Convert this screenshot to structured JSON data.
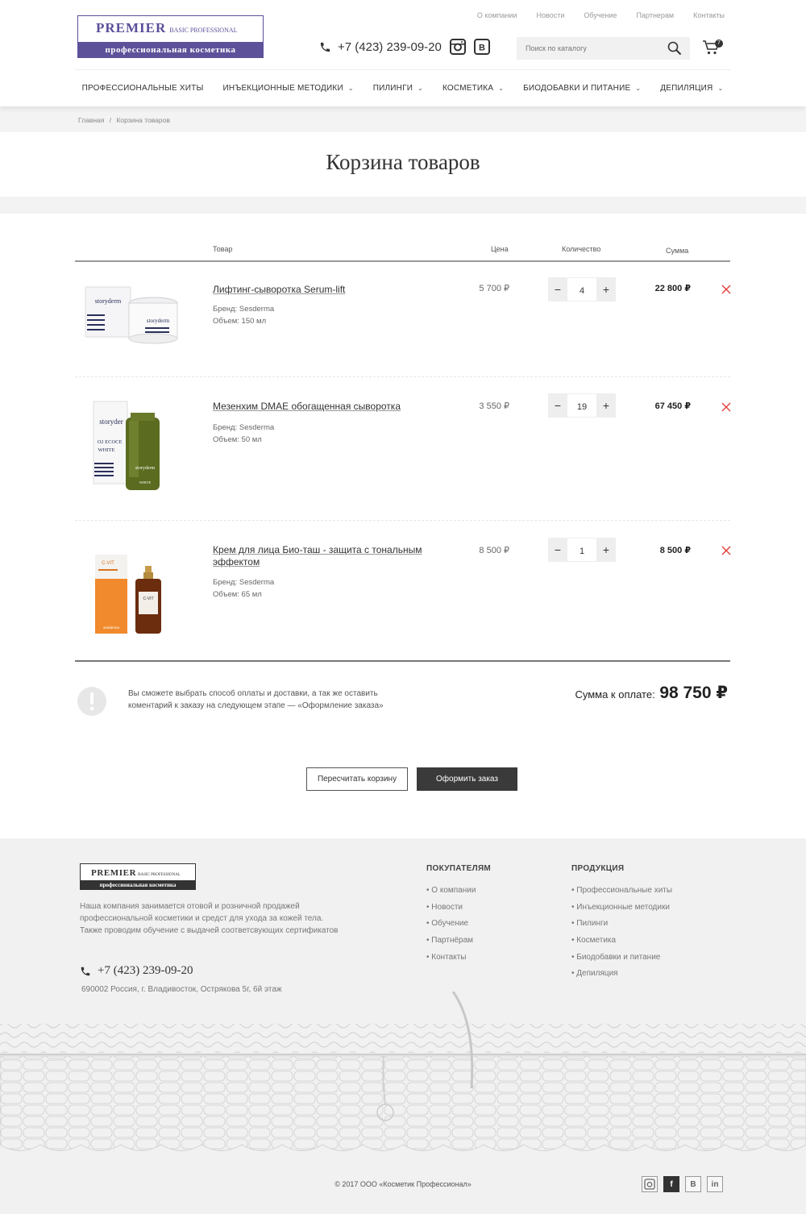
{
  "header": {
    "logo": {
      "brand": "PREMIER",
      "tagline": "BASIC PROFESSIONAL",
      "subtitle": "профессиональная косметика"
    },
    "top_links": [
      "О компании",
      "Новости",
      "Обучение",
      "Партнерам",
      "Контакты"
    ],
    "phone": "+7 (423) 239-09-20",
    "search_placeholder": "Поиск по каталогу",
    "cart_count": "7",
    "nav": [
      {
        "label": "ПРОФЕССИОНАЛЬНЫЕ ХИТЫ",
        "dropdown": false
      },
      {
        "label": "ИНЪЕКЦИОННЫЕ МЕТОДИКИ",
        "dropdown": true
      },
      {
        "label": "ПИЛИНГИ",
        "dropdown": true
      },
      {
        "label": "КОСМЕТИКА",
        "dropdown": true
      },
      {
        "label": "БИОДОБАВКИ И ПИТАНИЕ",
        "dropdown": true
      },
      {
        "label": "ДЕПИЛЯЦИЯ",
        "dropdown": true
      }
    ]
  },
  "breadcrumb": {
    "home": "Главная",
    "separator": "/",
    "current": "Корзина товаров"
  },
  "page_title": "Корзина товаров",
  "table": {
    "headers": {
      "product": "Товар",
      "price": "Цена",
      "quantity": "Количество",
      "sum": "Сумма"
    },
    "rows": [
      {
        "name": "Лифтинг-сыворотка Serum-lift",
        "brand": "Бренд: Sesderma",
        "volume": "Объем: 150 мл",
        "price": "5 700 ₽",
        "qty": "4",
        "sum": "22 800 ₽"
      },
      {
        "name": "Мезенхим DMAE обогащенная сыворотка",
        "brand": "Бренд: Sesderma",
        "volume": "Объем: 50 мл",
        "price": "3 550 ₽",
        "qty": "19",
        "sum": "67 450 ₽"
      },
      {
        "name": "Крем для лица Био-таш - защита с тональным эффектом",
        "brand": "Бренд: Sesderma",
        "volume": "Объем: 65 мл",
        "price": "8 500 ₽",
        "qty": "1",
        "sum": "8 500 ₽"
      }
    ]
  },
  "notice": "Вы сможете выбрать способ оплаты и доставки, а так же оставить коментарий к заказу на следующем этапе — «Оформление заказа»",
  "total": {
    "label": "Сумма к оплате:",
    "amount": "98 750 ₽"
  },
  "buttons": {
    "recalc": "Пересчитать корзину",
    "checkout": "Оформить заказ"
  },
  "footer": {
    "logo": {
      "brand": "PREMIER",
      "tagline": "BASIC PROFESSIONAL",
      "subtitle": "профессиональная косметика"
    },
    "description": "Наша компания занимается отовой и розничной продажей профессиональной косметики и средст для ухода за кожей тела. Также проводим обучение с выдачей соответсвующих сертификатов",
    "phone": "+7 (423) 239-09-20",
    "address": "690002 Россия, г. Владивосток, Острякова 5г, 6й этаж",
    "col1_title": "ПОКУПАТЕЛЯМ",
    "col1_items": [
      "• О компании",
      "• Новости",
      "• Обучение",
      "• Партнёрам",
      "• Контакты"
    ],
    "col2_title": "ПРОДУКЦИЯ",
    "col2_items": [
      "• Профессиональные хиты",
      "• Инъекционные методики",
      "• Пилинги",
      "• Косметика",
      "• Биодобавки и питание",
      "• Депиляция"
    ],
    "copyright": "© 2017 ООО «Косметик Профессионал»",
    "social": [
      "instagram-icon",
      "facebook-icon",
      "vk-icon",
      "linkedin-icon"
    ]
  },
  "colors": {
    "brand_purple": "#5d5299",
    "dark": "#3a3a3a",
    "delete_red": "#e53935"
  }
}
